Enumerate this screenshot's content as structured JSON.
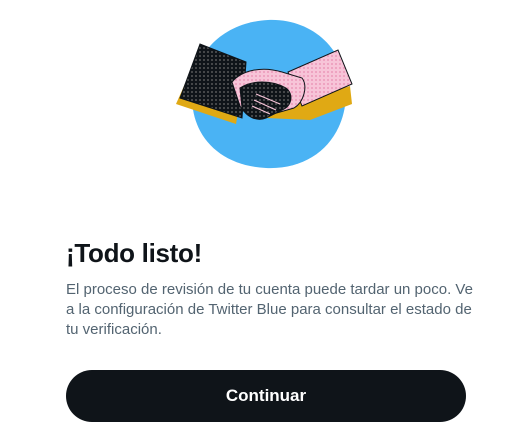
{
  "illustration": {
    "icon": "handshake-illustration",
    "circle_color": "#4ab3f4",
    "accent_color": "#e0a914",
    "hand_left_color": "#0f1419",
    "hand_right_color": "#f5b8cf"
  },
  "title": "¡Todo listo!",
  "body": "El proceso de revisión de tu cuenta puede tardar un poco. Ve a la configuración de Twitter Blue para consultar el estado de tu verificación.",
  "button": {
    "label": "Continuar",
    "color": "#0f1419"
  }
}
